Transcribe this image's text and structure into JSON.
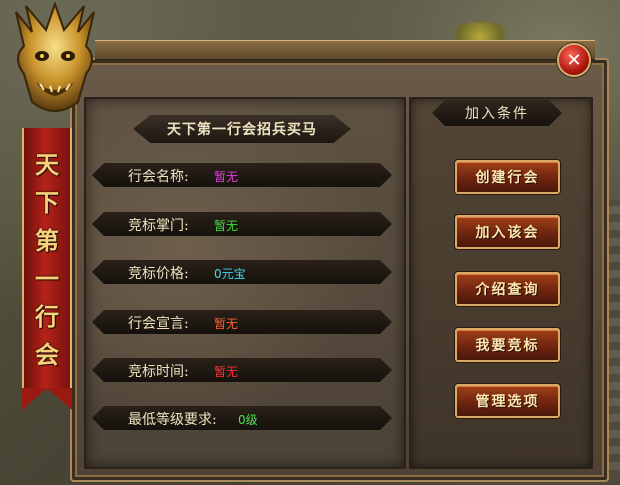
{
  "banner": {
    "chars": [
      "天",
      "下",
      "第",
      "一",
      "行",
      "会"
    ]
  },
  "title": "天下第一行会招兵买马",
  "info_rows": [
    {
      "label": "行会名称:",
      "value": "暂无",
      "value_color": "#e040e0"
    },
    {
      "label": "竞标掌门:",
      "value": "暂无",
      "value_color": "#40e040"
    },
    {
      "label": "竞标价格:",
      "value": "0元宝",
      "value_color": "#40d8f0"
    },
    {
      "label": "行会宣言:",
      "value": "暂无",
      "value_color": "#ff6030"
    },
    {
      "label": "竞标时间:",
      "value": "暂无",
      "value_color": "#ff3030"
    },
    {
      "label": "最低等级要求:",
      "value": "0级",
      "value_color": "#50e050"
    }
  ],
  "sidebar": {
    "heading": "加入条件",
    "buttons": [
      "创建行会",
      "加入该会",
      "介绍查询",
      "我要竞标",
      "管理选项"
    ]
  },
  "icons": {
    "close": "close-icon",
    "dragon": "dragon-emblem-icon"
  },
  "colors": {
    "banner_red": "#b4231a",
    "gold_text": "#f5d37a",
    "button_brown": "#7a2a12"
  }
}
